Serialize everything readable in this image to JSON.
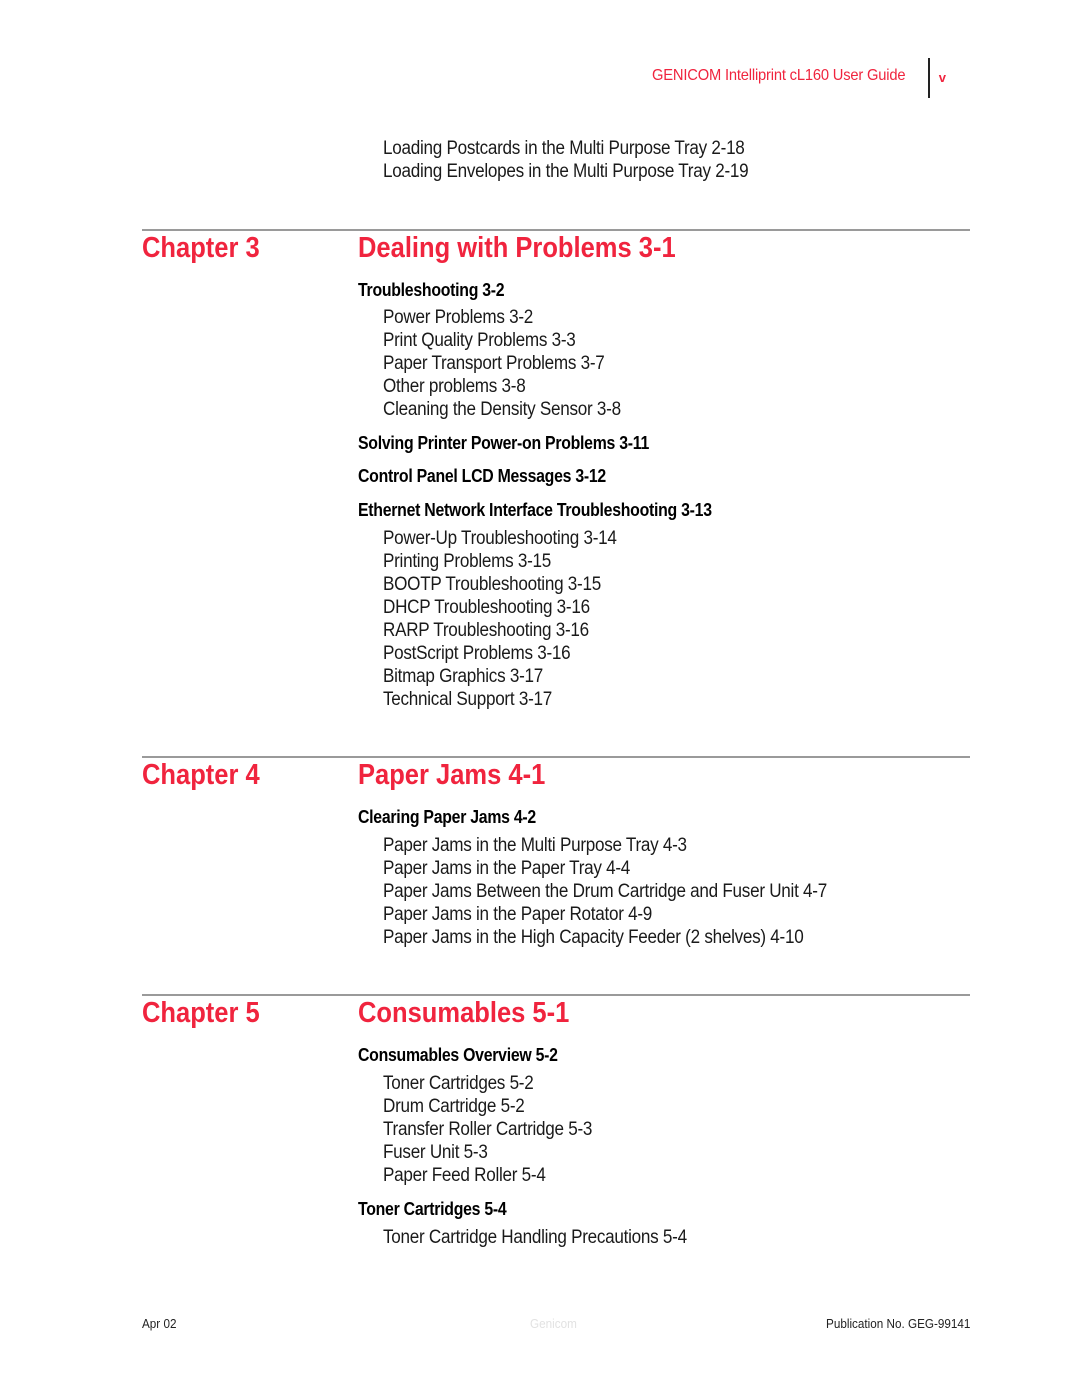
{
  "header": {
    "title": "GENICOM Intelliprint cL160 User Guide",
    "page_number": "v"
  },
  "carryover": [
    "Loading Postcards in the Multi Purpose Tray 2-18",
    "Loading Envelopes in the Multi Purpose Tray 2-19"
  ],
  "chapters": [
    {
      "label": "Chapter 3",
      "title": "Dealing with Problems 3-1",
      "sections": [
        {
          "title": "Troubleshooting 3-2",
          "items": [
            "Power Problems 3-2",
            "Print Quality Problems 3-3",
            "Paper Transport Problems 3-7",
            "Other problems 3-8",
            "Cleaning the Density Sensor 3-8"
          ]
        },
        {
          "title": "Solving Printer Power-on Problems 3-11",
          "items": []
        },
        {
          "title": "Control Panel LCD Messages 3-12",
          "items": []
        },
        {
          "title": "Ethernet Network Interface Troubleshooting 3-13",
          "items": [
            "Power-Up Troubleshooting 3-14",
            "Printing Problems 3-15",
            "BOOTP Troubleshooting 3-15",
            "DHCP Troubleshooting 3-16",
            "RARP Troubleshooting 3-16",
            "PostScript Problems 3-16",
            "Bitmap Graphics 3-17",
            "Technical Support 3-17"
          ]
        }
      ]
    },
    {
      "label": "Chapter 4",
      "title": "Paper Jams 4-1",
      "sections": [
        {
          "title": "Clearing Paper Jams 4-2",
          "items": [
            "Paper Jams in the Multi Purpose Tray 4-3",
            "Paper Jams in the Paper Tray 4-4",
            "Paper Jams Between the Drum Cartridge and Fuser Unit 4-7",
            "Paper Jams in the Paper Rotator 4-9",
            "Paper Jams in the High Capacity Feeder (2 shelves) 4-10"
          ]
        }
      ]
    },
    {
      "label": "Chapter 5",
      "title": "Consumables 5-1",
      "sections": [
        {
          "title": "Consumables Overview 5-2",
          "items": [
            "Toner Cartridges 5-2",
            "Drum Cartridge 5-2",
            "Transfer Roller Cartridge 5-3",
            "Fuser Unit 5-3",
            "Paper Feed Roller 5-4"
          ]
        },
        {
          "title": "Toner Cartridges 5-4",
          "items": [
            "Toner Cartridge Handling Precautions 5-4"
          ]
        }
      ]
    }
  ],
  "footer": {
    "date": "Apr 02",
    "watermark": "Genicom",
    "publication": "Publication No. GEG-99141"
  },
  "colors": {
    "accent": "#f0243e",
    "rule": "#9a9a9a"
  }
}
